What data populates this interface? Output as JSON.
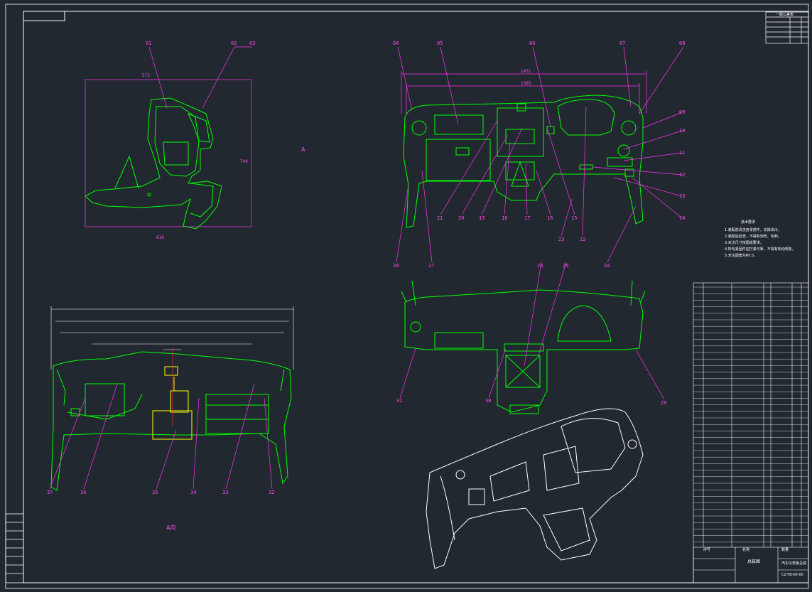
{
  "colors": {
    "background": "#212830",
    "frame": "#ffffff",
    "part_outline": "#00ff00",
    "leader_line": "#ff33ee",
    "highlight_part": "#ffff00",
    "isometric_view": "#ffffff"
  },
  "side_view": {
    "part_labels": [
      {
        "id": "side-01",
        "text": "01"
      },
      {
        "id": "side-02",
        "text": "02"
      },
      {
        "id": "side-03",
        "text": "03"
      }
    ],
    "dimensions": {
      "top": "573",
      "right": "749",
      "bottom": "810"
    }
  },
  "section_marker": "A",
  "front_view": {
    "part_labels": [
      {
        "id": "fv-04",
        "text": "04"
      },
      {
        "id": "fv-05",
        "text": "05"
      },
      {
        "id": "fv-06",
        "text": "06"
      },
      {
        "id": "fv-07",
        "text": "07"
      },
      {
        "id": "fv-08",
        "text": "08"
      },
      {
        "id": "fv-09",
        "text": "09"
      },
      {
        "id": "fv-10",
        "text": "10"
      },
      {
        "id": "fv-11",
        "text": "11"
      },
      {
        "id": "fv-12",
        "text": "12"
      },
      {
        "id": "fv-13",
        "text": "13"
      },
      {
        "id": "fv-14",
        "text": "14"
      },
      {
        "id": "fv-15",
        "text": "15"
      },
      {
        "id": "fv-16",
        "text": "16"
      },
      {
        "id": "fv-17",
        "text": "17"
      },
      {
        "id": "fv-18",
        "text": "18"
      },
      {
        "id": "fv-19",
        "text": "19"
      },
      {
        "id": "fv-20",
        "text": "20"
      },
      {
        "id": "fv-21",
        "text": "21"
      },
      {
        "id": "fv-22",
        "text": "22"
      },
      {
        "id": "fv-23",
        "text": "23"
      },
      {
        "id": "fv-24",
        "text": "24"
      },
      {
        "id": "fv-27",
        "text": "27"
      },
      {
        "id": "fv-28",
        "text": "28"
      }
    ],
    "dimensions": {
      "overall": "1451",
      "inner": "1385"
    }
  },
  "rear_view": {
    "part_labels": [
      {
        "id": "rv-25",
        "text": "25"
      },
      {
        "id": "rv-26",
        "text": "26"
      },
      {
        "id": "rv-29",
        "text": "29"
      },
      {
        "id": "rv-30",
        "text": "30"
      },
      {
        "id": "rv-31",
        "text": "31"
      }
    ]
  },
  "section_view": {
    "title": "A向",
    "part_labels": [
      {
        "id": "sv-37",
        "text": "37"
      },
      {
        "id": "sv-36",
        "text": "36"
      },
      {
        "id": "sv-35",
        "text": "35"
      },
      {
        "id": "sv-34",
        "text": "34"
      },
      {
        "id": "sv-33",
        "text": "33"
      },
      {
        "id": "sv-32",
        "text": "32"
      }
    ]
  },
  "technical_notes": {
    "title": "技术要求",
    "items": [
      "1.装配前清洗各零部件，去除油污。",
      "2.装配后检查，不得有划伤、毛刺。",
      "3.未注尺寸按图纸要求。",
      "4.所有紧固件应拧紧可靠，不得有松动现象。",
      "5.未注圆角为R0.5。"
    ]
  },
  "title_block": {
    "drawing_title": "总装图",
    "part_name": "汽车仪表板总成",
    "drawing_number": "CZ-YB-00-00",
    "header_left": "序号",
    "header_name": "名称",
    "header_qty": "数量"
  },
  "revision_table": {
    "title": "一般公差表"
  }
}
